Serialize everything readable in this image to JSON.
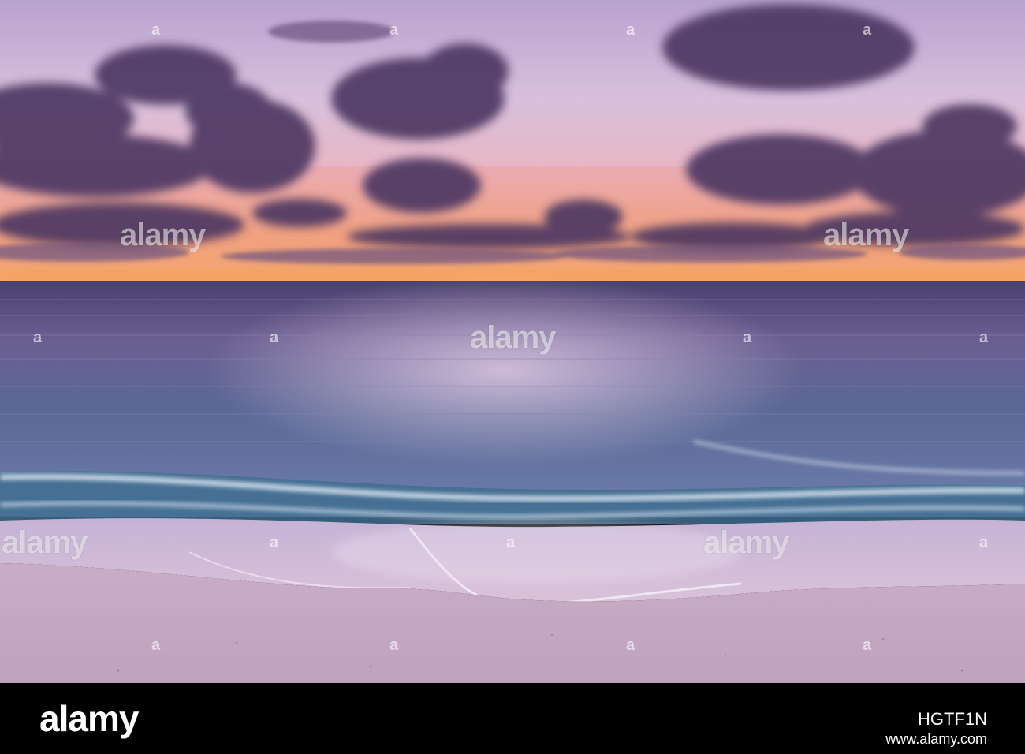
{
  "watermark": {
    "brand": "alamy",
    "marker": "a"
  },
  "footer": {
    "logo": "alamy",
    "image_id": "HGTF1N",
    "url": "www.alamy.com"
  },
  "colors": {
    "sky_top": "#c7aed6",
    "sky_glow": "#f2a46e",
    "cloud": "#4f3a63",
    "sea": "#5e5a8a",
    "surf": "#dfe6f2",
    "sand": "#cdb4c8",
    "footer_bg": "#000000"
  }
}
